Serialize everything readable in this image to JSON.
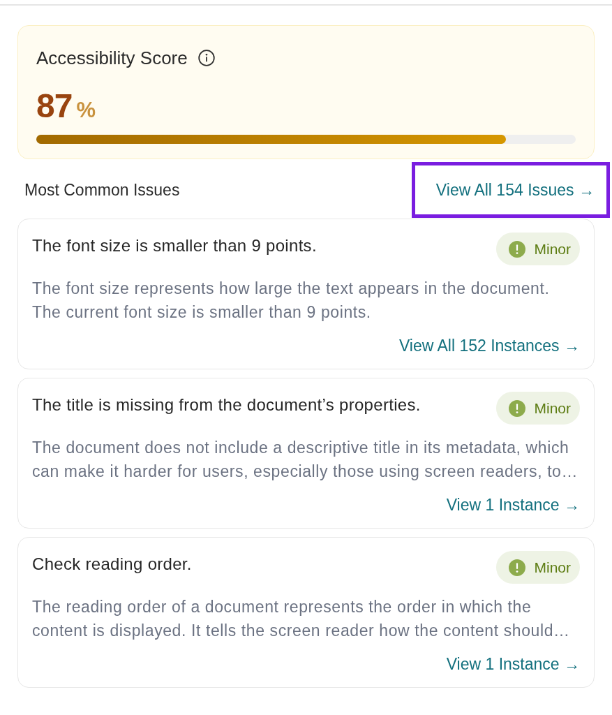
{
  "score_card": {
    "title": "Accessibility Score",
    "value": "87",
    "unit": "%",
    "level": 0.87
  },
  "issues_section": {
    "heading": "Most Common Issues",
    "view_all_link": {
      "label": "View All 154 Issues →",
      "highlighted": true
    }
  },
  "issues": [
    {
      "title": "The font size is smaller than 9 points.",
      "severity": "Minor",
      "description": "The font size represents how large the text appears in the document. The current font size is smaller than 9 points.",
      "link": "View All 152 Instances →"
    },
    {
      "title": "The title is missing from the document’s properties.",
      "severity": "Minor",
      "description": "The document does not include a descriptive title in its metadata, which can make it harder for users, especially those using screen readers, to…",
      "link": "View 1 Instance →"
    },
    {
      "title": "Check reading order.",
      "severity": "Minor",
      "description": "The reading order of a document represents the order in which the content is displayed. It tells the screen reader how the content should…",
      "link": "View 1 Instance →"
    }
  ]
}
